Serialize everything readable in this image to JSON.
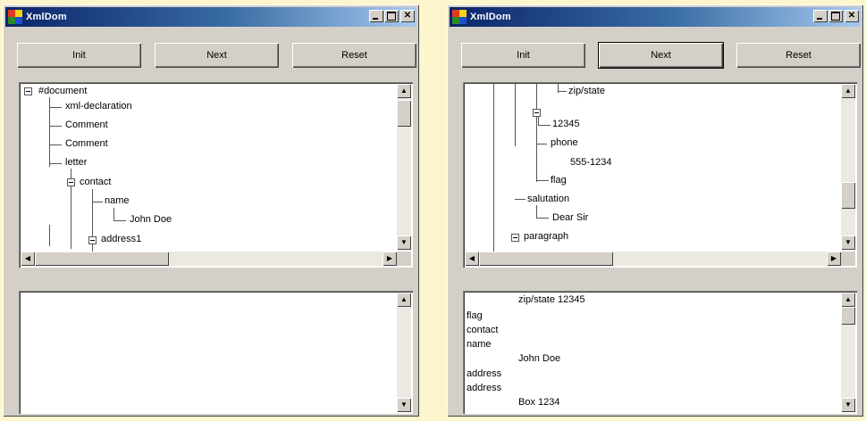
{
  "windows": [
    {
      "title": "XmlDom",
      "buttons": [
        "Init",
        "Next",
        "Reset"
      ],
      "tree_nodes": [
        "#document",
        "xml-declaration",
        "Comment",
        "Comment",
        "letter",
        "contact",
        "name",
        "John Doe",
        "address1"
      ],
      "text_lines": []
    },
    {
      "title": "XmlDom",
      "buttons": [
        "Init",
        "Next",
        "Reset"
      ],
      "tree_nodes": [
        "zip/state",
        "12345",
        "phone",
        "555-1234",
        "flag",
        "salutation",
        "Dear Sir",
        "paragraph"
      ],
      "text_lines": [
        "zip/state 12345",
        "flag",
        "contact",
        "name",
        "John Doe",
        "address",
        "address",
        "Box 1234"
      ]
    }
  ]
}
